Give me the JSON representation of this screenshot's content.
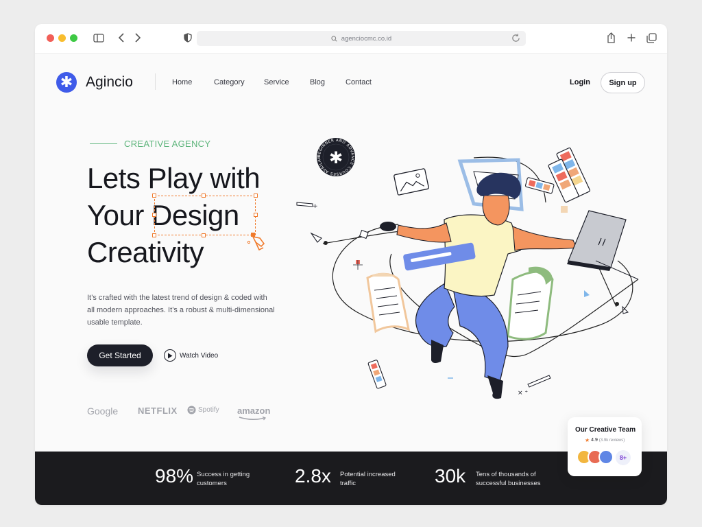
{
  "browser": {
    "url": "agenciocmc.co.id"
  },
  "brand": {
    "logo_glyph": "✱",
    "name": "Agincio",
    "accent": "#3f5be9"
  },
  "nav": {
    "links": [
      "Home",
      "Category",
      "Service",
      "Blog",
      "Contact"
    ],
    "login": "Login",
    "signup": "Sign up"
  },
  "hero": {
    "eyebrow": "CREATIVE AGENCY",
    "headline_lines": [
      "Lets Play with",
      "Your Design",
      "Creativity"
    ],
    "description": "It’s crafted with the latest trend of design & coded with all modern approaches. It’s a robust & multi-dimensional usable template.",
    "cta": "Get Started",
    "watch": "Watch Video",
    "badge_text": "BEGINNER AND ADVANCE COURSES AVAILABLE"
  },
  "partners": [
    "Google",
    "NETFLIX",
    "Spotify",
    "amazon"
  ],
  "stats": [
    {
      "value": "98%",
      "label": "Success in getting customers"
    },
    {
      "value": "2.8x",
      "label": "Potential increased traffic"
    },
    {
      "value": "30k",
      "label": "Tens of thousands of successful businesses"
    }
  ],
  "team_card": {
    "title": "Our Creative Team",
    "rating": "4.9",
    "reviews": "(3.9k reviews)",
    "more": "8+"
  },
  "colors": {
    "dark": "#1d1f29",
    "green": "#5cb47a",
    "orange": "#f07a2b",
    "stats_bg": "#1b1b1e"
  }
}
